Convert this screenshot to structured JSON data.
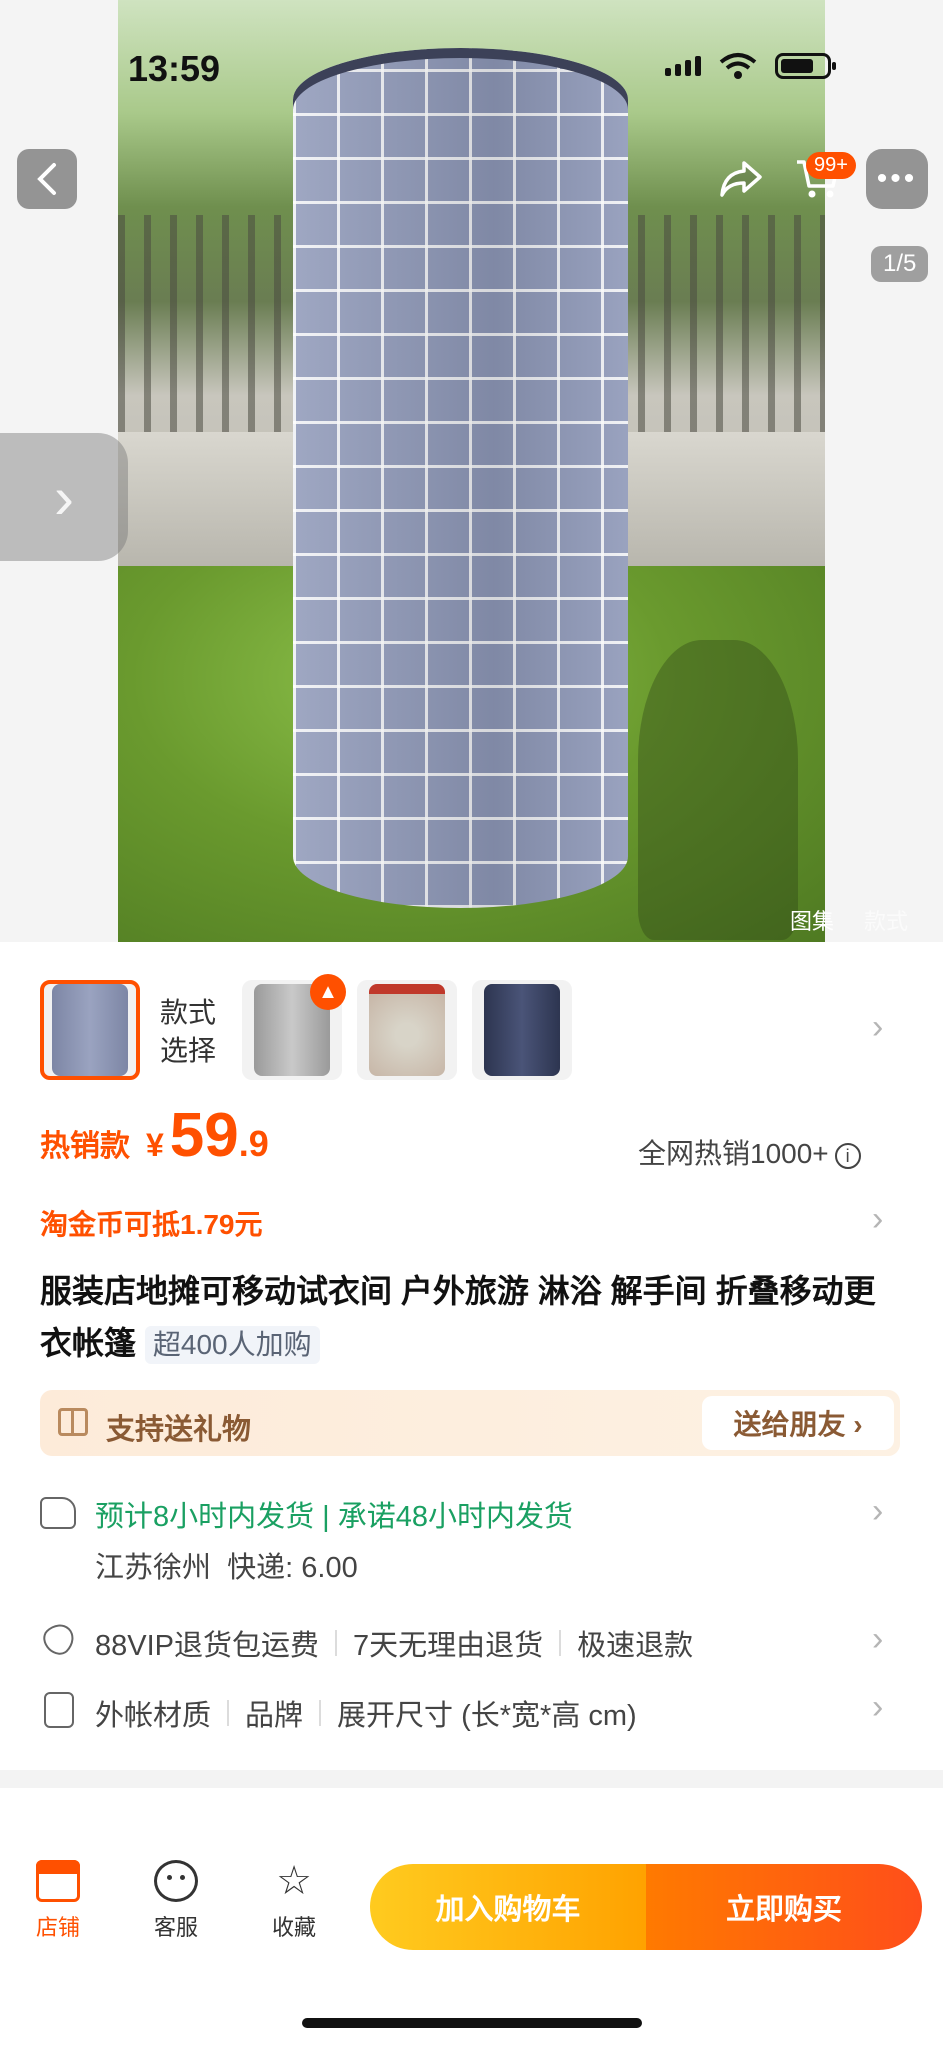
{
  "status_bar": {
    "time": "13:59"
  },
  "header": {
    "cart_badge": "99+",
    "page_indicator": "1/5",
    "gallery_tabs": [
      "图集",
      "款式"
    ]
  },
  "variants": {
    "label_line1": "款式",
    "label_line2": "选择",
    "count": 4,
    "selected_index": 0
  },
  "price": {
    "hot_label": "热销款",
    "currency": "¥",
    "integer": "59",
    "decimal": ".9",
    "sales_text": "全网热销1000+",
    "coin_text": "淘金币可抵1.79元"
  },
  "product": {
    "title": "服装店地摊可移动试衣间 户外旅游 淋浴 解手间 折叠移动更衣帐篷",
    "title_tag": "超400人加购"
  },
  "gift": {
    "text": "支持送礼物",
    "button": "送给朋友 ›"
  },
  "shipping": {
    "estimate": "预计8小时内发货",
    "promise": "承诺48小时内发货",
    "origin": "江苏徐州",
    "fee_label": "快递: 6.00"
  },
  "services": [
    "88VIP退货包运费",
    "7天无理由退货",
    "极速退款"
  ],
  "params": [
    "外帐材质",
    "品牌",
    "展开尺寸 (长*宽*高 cm)"
  ],
  "bottom_bar": {
    "store": "店铺",
    "service": "客服",
    "favorite": "收藏",
    "add_to_cart": "加入购物车",
    "buy_now": "立即购买"
  },
  "colors": {
    "accent": "#ff5000",
    "ship_green": "#1aa062"
  }
}
